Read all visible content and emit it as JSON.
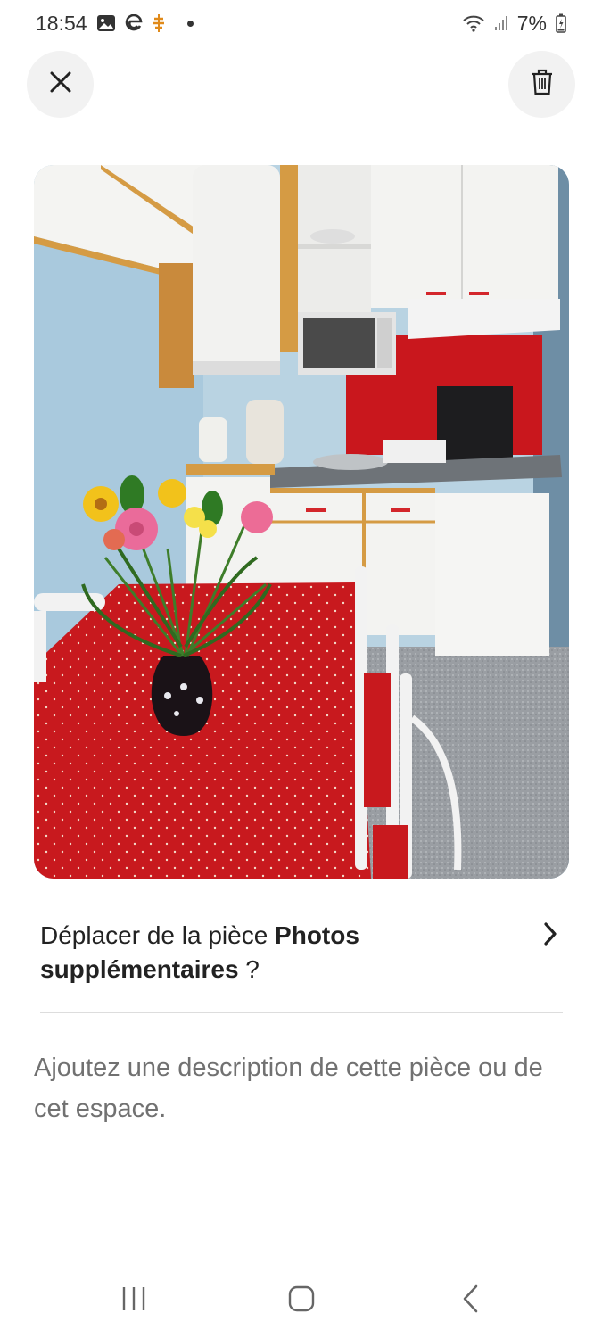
{
  "status_bar": {
    "time": "18:54",
    "battery": "7%",
    "icons": [
      "gallery-icon",
      "edge-browser-icon",
      "notification-icon",
      "wifi-icon",
      "signal-icon",
      "battery-charging-icon"
    ]
  },
  "header": {
    "close_icon": "close-icon",
    "delete_icon": "trash-icon"
  },
  "photo": {
    "subject": "kitchen-photo"
  },
  "move_row": {
    "prefix": "Déplacer de la pièce ",
    "room": "Photos supplémentaires",
    "suffix": " ?",
    "chevron": "chevron-right-icon"
  },
  "description": {
    "placeholder": "Ajoutez une description de cette pièce ou de cet espace."
  },
  "nav_bar": {
    "icons": [
      "recent-apps-icon",
      "home-icon",
      "back-icon"
    ]
  },
  "colors": {
    "background": "#ffffff",
    "button_bg": "#f2f2f2",
    "text": "#222222",
    "muted_text": "#717171",
    "divider": "#dddddd"
  }
}
